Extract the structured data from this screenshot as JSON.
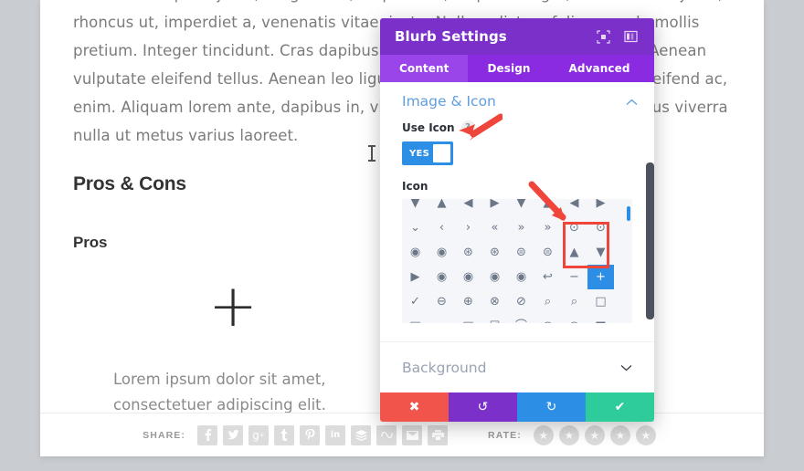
{
  "page": {
    "paragraph_1": "enim. Donec pede justo, fringilla vel, aliquet nec, vulputate eget, arcu. In enim justo, rhoncus ut, imperdiet a, venenatis vitae, justo. Nullam dictum felis eu pede mollis pretium. Integer tincidunt. Cras dapibus. Vivamus elementum semper nisi. Aenean vulputate eleifend tellus. Aenean leo ligula, porttitor eu, consequat vitae, eleifend ac, enim. Aliquam lorem ante, dapibus in, viverra quis, feugiat a, tellus. Phasellus viverra nulla ut metus varius laoreet.",
    "section_title": "Pros & Cons",
    "sub_title": "Pros",
    "blurb_icon": "+",
    "blurb_text": "Lorem ipsum dolor sit amet, consectetuer adipiscing elit."
  },
  "sharebar": {
    "share_label": "SHARE:",
    "rate_label": "RATE:",
    "share_icons": [
      {
        "name": "facebook-icon",
        "glyph": "f"
      },
      {
        "name": "twitter-icon",
        "glyph": "✈"
      },
      {
        "name": "googleplus-icon",
        "glyph": "g"
      },
      {
        "name": "tumblr-icon",
        "glyph": "t"
      },
      {
        "name": "pinterest-icon",
        "glyph": "p"
      },
      {
        "name": "linkedin-icon",
        "glyph": "in"
      },
      {
        "name": "buffer-icon",
        "glyph": "≣"
      },
      {
        "name": "stumbleupon-icon",
        "glyph": "∿"
      },
      {
        "name": "email-icon",
        "glyph": "✉"
      },
      {
        "name": "print-icon",
        "glyph": "⎙"
      }
    ],
    "stars": [
      "★",
      "★",
      "★",
      "★",
      "★"
    ]
  },
  "modal": {
    "title": "Blurb Settings",
    "header_icons": [
      {
        "name": "fullscreen-icon"
      },
      {
        "name": "layout-columns-icon"
      }
    ],
    "tabs": [
      {
        "label": "Content",
        "active": true
      },
      {
        "label": "Design",
        "active": false
      },
      {
        "label": "Advanced",
        "active": false
      }
    ],
    "section": {
      "title": "Image & Icon",
      "collapse_icon": "chevron-up-icon"
    },
    "use_icon": {
      "label": "Use Icon",
      "help": "?",
      "value": "YES"
    },
    "icon_field": {
      "label": "Icon",
      "selected_glyph": "+",
      "glyphs": [
        "▼",
        "▲",
        "◀",
        "▶",
        "▼",
        "▲",
        "◀",
        "▶",
        "⌄",
        "‹",
        "›",
        "«",
        "»",
        "»",
        "⊙",
        "⊙",
        "◉",
        "◉",
        "⊛",
        "⊛",
        "⊜",
        "⊜",
        "▲",
        "▼",
        "▶",
        "◉",
        "◉",
        "◉",
        "◉",
        "↩",
        "−",
        "+",
        "✓",
        "⊖",
        "⊕",
        "⊗",
        "⊘",
        "⌕",
        "⌕",
        "□",
        "▣",
        "▭",
        "▤",
        "☑",
        "⌒",
        "◉",
        "◉",
        "■"
      ]
    },
    "background": {
      "label": "Background",
      "expand_icon": "chevron-down-icon"
    },
    "footer": [
      {
        "name": "cancel-button",
        "glyph": "✖",
        "color": "#f0544a"
      },
      {
        "name": "undo-button",
        "glyph": "↺",
        "color": "#7b31c9"
      },
      {
        "name": "redo-button",
        "glyph": "↻",
        "color": "#2c8ee5"
      },
      {
        "name": "save-button",
        "glyph": "✔",
        "color": "#2ecc9b"
      }
    ]
  },
  "colors": {
    "header_purple": "#7b31c9",
    "tabs_purple": "#8a2be2",
    "tab_active": "#9a45ea",
    "accent_blue": "#2c8ee5",
    "annotation_red": "#f0453a",
    "page_bg": "#c9ccd1"
  }
}
